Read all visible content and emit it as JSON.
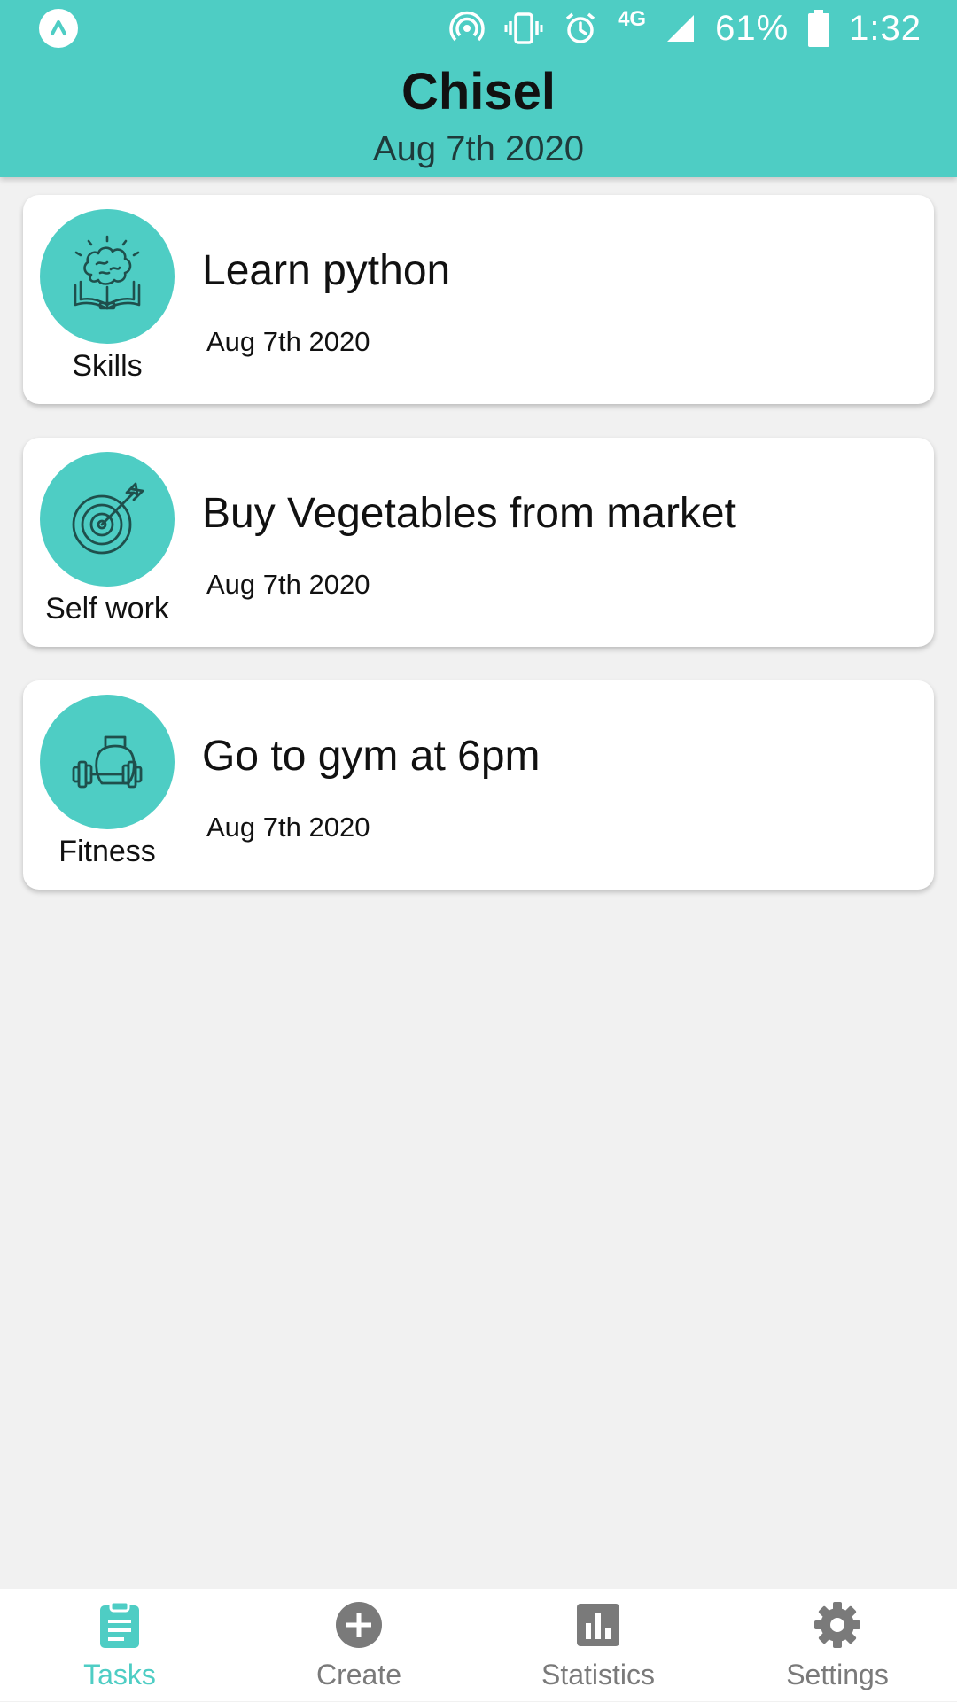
{
  "status_bar": {
    "battery_percent": "61%",
    "time": "1:32",
    "network": "4G",
    "icons": [
      "app-logo-icon",
      "hotspot-icon",
      "vibrate-icon",
      "alarm-icon",
      "signal-icon",
      "battery-icon"
    ]
  },
  "header": {
    "title": "Chisel",
    "date": "Aug 7th 2020"
  },
  "tasks": [
    {
      "category": "Skills",
      "icon": "brain-book-icon",
      "title": "Learn python",
      "date": "Aug 7th 2020"
    },
    {
      "category": "Self work",
      "icon": "target-icon",
      "title": "Buy Vegetables from market",
      "date": "Aug 7th 2020"
    },
    {
      "category": "Fitness",
      "icon": "dumbbell-kettlebell-icon",
      "title": "Go to gym at 6pm",
      "date": "Aug 7th 2020"
    }
  ],
  "bottom_nav": {
    "active": "Tasks",
    "items": [
      {
        "label": "Tasks",
        "icon": "clipboard-icon"
      },
      {
        "label": "Create",
        "icon": "add-circle-icon"
      },
      {
        "label": "Statistics",
        "icon": "bar-chart-icon"
      },
      {
        "label": "Settings",
        "icon": "gear-icon"
      }
    ]
  },
  "colors": {
    "accent": "#4ecdc4",
    "background": "#f1f1f1",
    "card": "#ffffff",
    "inactive_nav": "#7a7a7a",
    "icon_stroke": "#1f4f4c"
  }
}
